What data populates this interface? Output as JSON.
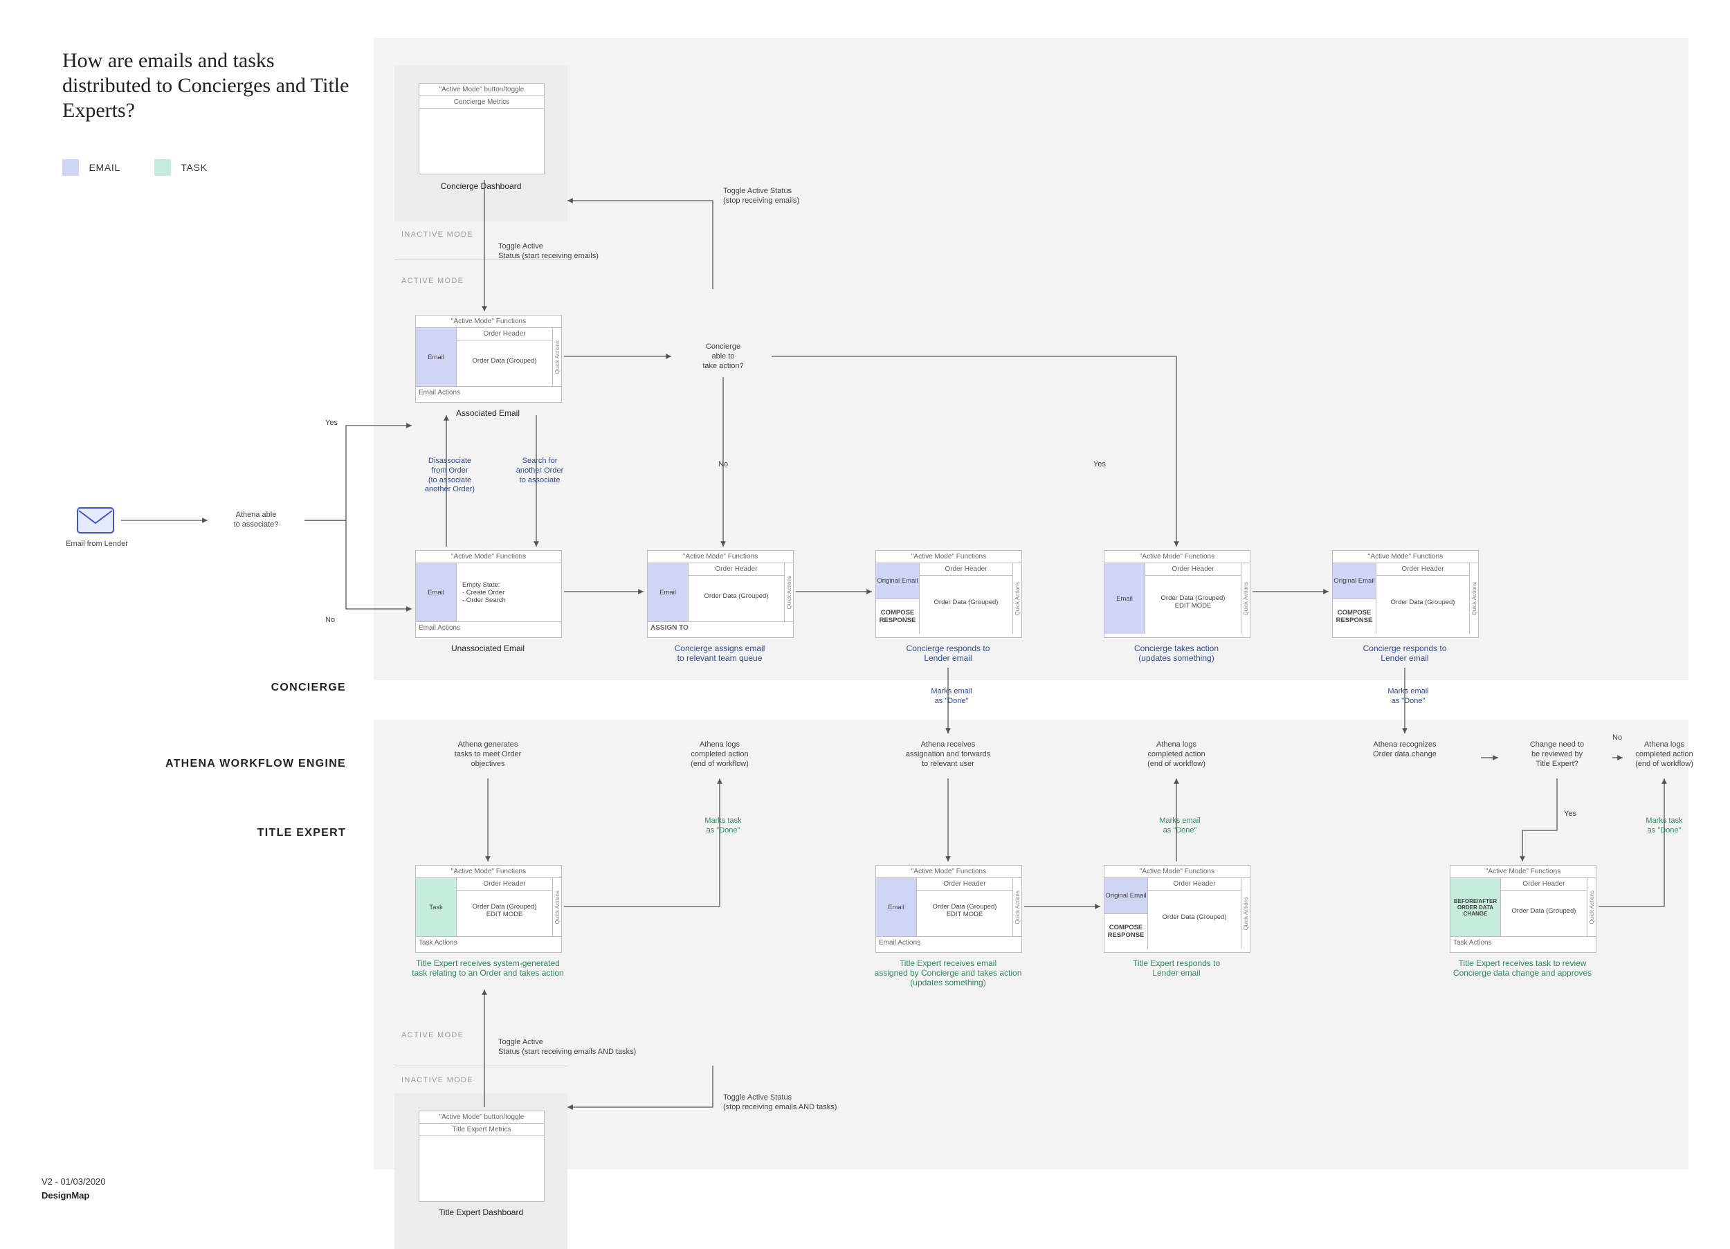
{
  "meta": {
    "title": "How are emails and tasks distributed to Concierges and Title Experts?",
    "version": "V2 - 01/03/2020",
    "brand": "DesignMap"
  },
  "legend": {
    "email_label": "EMAIL",
    "task_label": "TASK",
    "email_color": "#d0d4f5",
    "task_color": "#c6ecdd"
  },
  "lanes": {
    "concierge": "CONCIERGE",
    "engine": "ATHENA WORKFLOW ENGINE",
    "title_expert": "TITLE EXPERT"
  },
  "modes": {
    "inactive": "INACTIVE MODE",
    "active": "ACTIVE MODE"
  },
  "annotations": {
    "email_from_lender": "Email from Lender",
    "athena_associate_q": "Athena able\nto associate?",
    "yes": "Yes",
    "no": "No",
    "toggle_active_start_emails": "Toggle Active\nStatus (start receiving emails)",
    "toggle_active_stop_emails": "Toggle Active Status\n(stop receiving emails)",
    "concierge_take_action_q": "Concierge\nable to\ntake action?",
    "disassociate": "Disassociate\nfrom Order\n(to associate\nanother Order)",
    "search_another": "Search for\nanother Order\nto associate",
    "marks_email_done": "Marks email\nas \"Done\"",
    "marks_task_done": "Marks task\nas \"Done\"",
    "athena_generates_tasks": "Athena generates\ntasks to meet Order\nobjectives",
    "athena_logs_completed": "Athena logs\ncompleted action\n(end of workflow)",
    "athena_receives_assignation": "Athena receives\nassignation and forwards\nto relevant user",
    "athena_recognizes_change": "Athena recognizes\nOrder data change",
    "review_by_te_q": "Change need to\nbe reviewed by\nTitle Expert?",
    "toggle_active_start_both": "Toggle Active\nStatus (start receiving emails AND tasks)",
    "toggle_active_stop_both": "Toggle Active Status\n(stop receiving emails AND tasks)"
  },
  "cards": {
    "concierge_dash": {
      "top": "\"Active Mode\" button/toggle",
      "metrics": "Concierge Metrics",
      "caption": "Concierge Dashboard"
    },
    "associated_email": {
      "top": "\"Active Mode\" Functions",
      "left": "Email",
      "hdr": "Order Header",
      "body": "Order Data (Grouped)",
      "footer": "Email Actions",
      "caption": "Associated Email"
    },
    "unassociated_email": {
      "top": "\"Active Mode\" Functions",
      "left": "Email",
      "body_lines": "Empty State:\n- Create Order\n- Order Search",
      "footer": "Email Actions",
      "caption": "Unassociated Email"
    },
    "assign": {
      "top": "\"Active Mode\" Functions",
      "left": "Email",
      "hdr": "Order Header",
      "body": "Order Data (Grouped)",
      "footer": "ASSIGN TO",
      "caption": "Concierge assigns email\nto relevant team queue"
    },
    "respond1": {
      "top": "\"Active Mode\" Functions",
      "left1": "Original Email",
      "left2": "COMPOSE\nRESPONSE",
      "hdr": "Order Header",
      "body": "Order Data (Grouped)",
      "caption": "Concierge responds to\nLender email"
    },
    "take_action": {
      "top": "\"Active Mode\" Functions",
      "left": "Email",
      "hdr": "Order Header",
      "body": "Order Data (Grouped)\nEDIT MODE",
      "caption": "Concierge takes action\n(updates something)"
    },
    "respond2": {
      "top": "\"Active Mode\" Functions",
      "left1": "Original Email",
      "left2": "COMPOSE\nRESPONSE",
      "hdr": "Order Header",
      "body": "Order Data (Grouped)",
      "caption": "Concierge responds to\nLender email"
    },
    "te_task": {
      "top": "\"Active Mode\" Functions",
      "left": "Task",
      "hdr": "Order Header",
      "body": "Order Data (Grouped)\nEDIT MODE",
      "footer": "Task Actions",
      "caption": "Title Expert receives system-generated\ntask relating to an Order and takes action"
    },
    "te_email_assigned": {
      "top": "\"Active Mode\" Functions",
      "left": "Email",
      "hdr": "Order Header",
      "body": "Order Data (Grouped)\nEDIT MODE",
      "footer": "Email Actions",
      "caption": "Title Expert receives email\nassigned by Concierge and takes action\n(updates something)"
    },
    "te_respond": {
      "top": "\"Active Mode\" Functions",
      "left1": "Original Email",
      "left2": "COMPOSE\nRESPONSE",
      "hdr": "Order Header",
      "body": "Order Data (Grouped)",
      "caption": "Title Expert responds to\nLender email"
    },
    "te_review": {
      "top": "\"Active Mode\" Functions",
      "left": "BEFORE/AFTER\nORDER DATA\nCHANGE",
      "hdr": "Order Header",
      "body": "Order Data (Grouped)",
      "footer": "Task Actions",
      "caption": "Title Expert receives task to review\nConcierge data change and approves"
    },
    "te_dash": {
      "top": "\"Active Mode\" button/toggle",
      "metrics": "Title Expert Metrics",
      "caption": "Title Expert Dashboard"
    },
    "side_label": "Quick Actions"
  }
}
